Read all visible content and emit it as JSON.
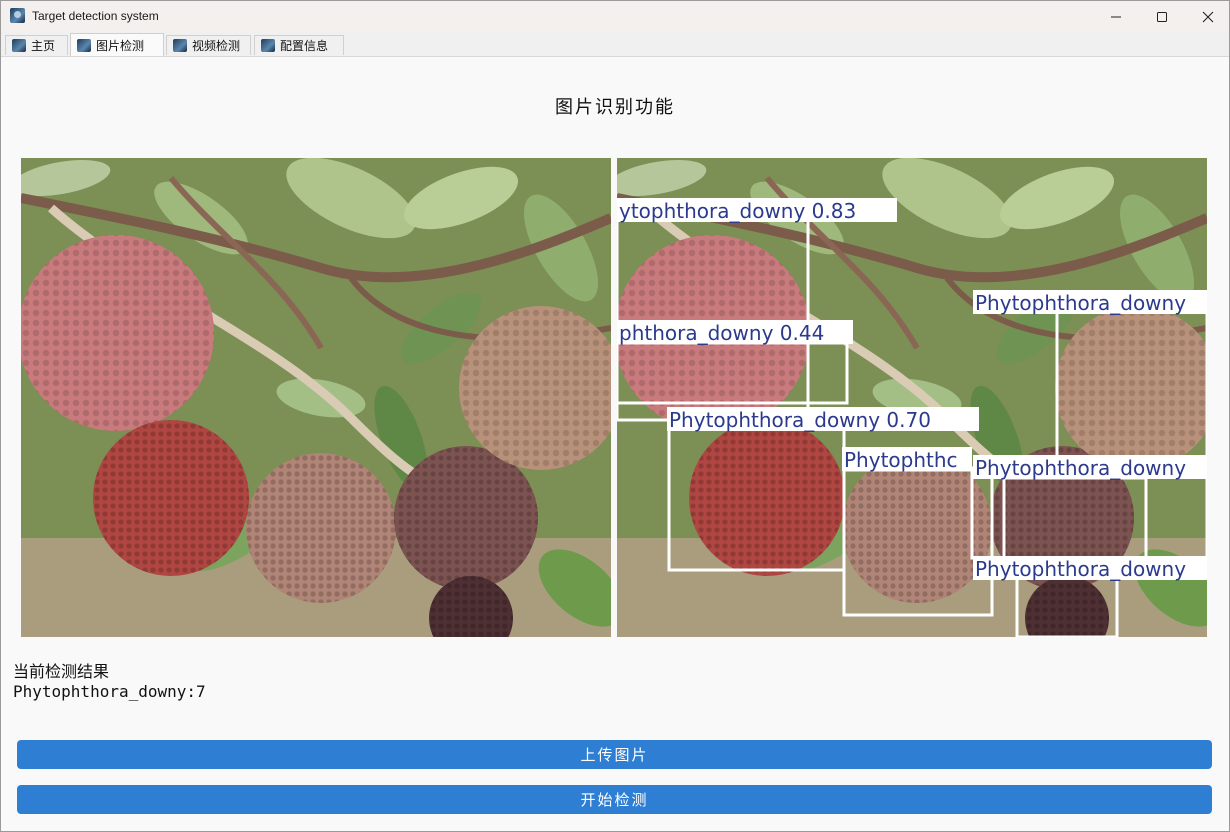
{
  "window": {
    "title": "Target detection system"
  },
  "tabs": [
    {
      "label": "主页",
      "active": false
    },
    {
      "label": "图片检测",
      "active": true
    },
    {
      "label": "视频检测",
      "active": false
    },
    {
      "label": "配置信息",
      "active": false
    }
  ],
  "page": {
    "title": "图片识别功能"
  },
  "detections": [
    {
      "label": "ytophthora_downy 0.83"
    },
    {
      "label": "phthora_downy 0.44"
    },
    {
      "label": "Phytophthora_downy"
    },
    {
      "label": "Phytophthora_downy 0.70"
    },
    {
      "label": "Phytophthc"
    },
    {
      "label": "Phytophthora_downy"
    },
    {
      "label": "Phytophthora_downy"
    }
  ],
  "result": {
    "label": "当前检测结果",
    "value": "Phytophthora_downy:7"
  },
  "buttons": {
    "upload": "上传图片",
    "detect": "开始检测"
  },
  "colors": {
    "button": "#2e7fd3",
    "box_label_text": "#2b3a8c",
    "box_border": "#ffffff"
  },
  "icons": {
    "app": "app-logo-icon",
    "minimize": "minimize-icon",
    "maximize": "maximize-icon",
    "close": "close-icon"
  }
}
